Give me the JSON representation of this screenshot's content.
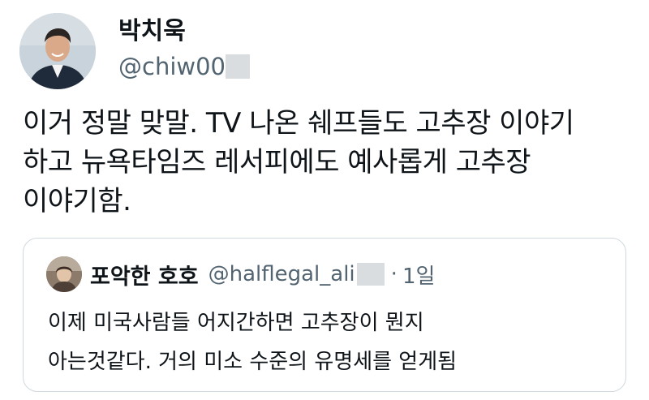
{
  "author": {
    "display_name": "박치욱",
    "handle": "@chiw00",
    "avatar_icon": "person-avatar-icon"
  },
  "tweet": {
    "lines": [
      "이거 정말 맞말. TV 나온 쉐프들도 고추장 이야기",
      "하고 뉴욕타임즈 레서피에도 예사롭게 고추장",
      "이야기함."
    ]
  },
  "quote": {
    "display_name": "포악한 호호",
    "handle": "@halflegal_ali",
    "separator": "·",
    "time": "1일",
    "avatar_icon": "person-avatar-icon",
    "lines": [
      "이제 미국사람들 어지간하면 고추장이 뭔지",
      "아는것같다. 거의 미소 수준의 유명세를 얻게됨"
    ]
  },
  "colors": {
    "text_primary": "#0f1419",
    "text_secondary": "#536471",
    "card_border": "#cfd9de",
    "redaction": "#d9dde0"
  }
}
